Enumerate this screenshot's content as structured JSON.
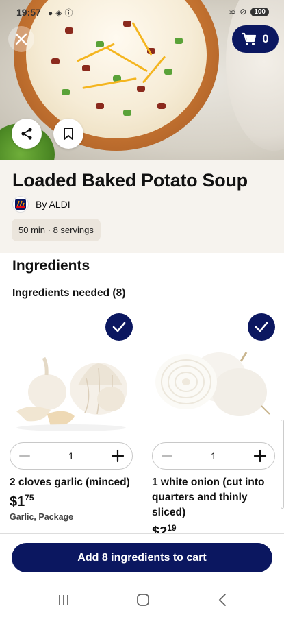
{
  "status_bar": {
    "time": "19:57",
    "battery": "100"
  },
  "cart": {
    "count": "0"
  },
  "recipe": {
    "title": "Loaded Baked Potato Soup",
    "byline": "By ALDI",
    "logo_text": "ALDI",
    "meta": "50 min · 8 servings"
  },
  "ingredients": {
    "heading": "Ingredients",
    "needed_label": "Ingredients needed (8)",
    "items": [
      {
        "name": "2 cloves garlic (minced)",
        "price_dollars": "$1",
        "price_cents": "75",
        "package": "Garlic, Package",
        "qty": "1"
      },
      {
        "name": "1 white onion (cut into quarters and thinly sliced)",
        "price_dollars": "$2",
        "price_cents": "19",
        "package": "",
        "qty": "1"
      }
    ]
  },
  "cta": {
    "label": "Add 8 ingredients to cart"
  },
  "colors": {
    "brand_navy": "#0b1760",
    "header_bg": "#f6f3ee",
    "pill_bg": "#ebe5dc"
  },
  "icons": [
    "close-icon",
    "cart-icon",
    "share-icon",
    "bookmark-icon",
    "check-icon",
    "minus-icon",
    "plus-icon",
    "recents-icon",
    "home-icon",
    "back-icon"
  ]
}
